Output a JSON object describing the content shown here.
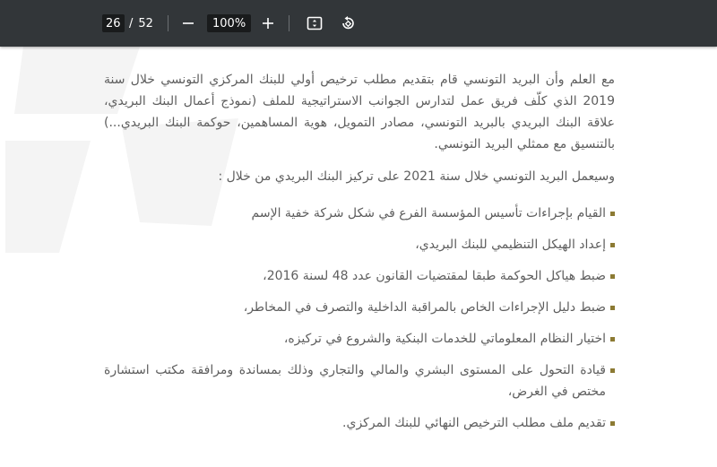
{
  "toolbar": {
    "current_page": "26",
    "page_separator": "/",
    "total_pages": "52",
    "zoom_level": "100%",
    "icons": [
      "minus-icon",
      "plus-icon",
      "fit-page-icon",
      "rotate-icon"
    ],
    "background_color": "#323639"
  },
  "document": {
    "paragraph_1": "مع العلم وأن البريد التونسي قام بتقديم مطلب ترخيص أولي للبنك المركزي التونسي خلال سنة 2019 الذي كلّف فريق عمل لتدارس الجوانب الاستراتيجية للملف (نموذج أعمال البنك البريدي، علاقة البنك البريدي بالبريد التونسي، مصادر التمويل، هوية المساهمين، حوكمة البنك البريدي...) بالتنسيق مع ممثلي البريد التونسي.",
    "paragraph_2": "وسيعمل البريد التونسي خلال سنة 2021 على تركيز البنك البريدي من خلال :",
    "bullets": [
      "القيام بإجراءات تأسيس المؤسسة الفرع في شكل شركة خفية الإسم",
      "إعداد الهيكل التنظيمي للبنك البريدي،",
      "ضبط هياكل الحوكمة طبقا لمقتضيات القانون عدد 48 لسنة 2016،",
      "ضبط دليل الإجراءات الخاص بالمراقبة الداخلية والتصرف في المخاطر،",
      "اختيار النظام المعلوماتي للخدمات البنكية والشروع في تركيزه،",
      "قيادة التحول على المستوى البشري والمالي والتجاري وذلك بمساندة ومرافقة مكتب استشارة مختص في الغرض،",
      "تقديم ملف مطلب الترخيص النهائي للبنك المركزي."
    ],
    "text_color": "#5e5e5e",
    "bullet_color": "#8c7a33"
  }
}
